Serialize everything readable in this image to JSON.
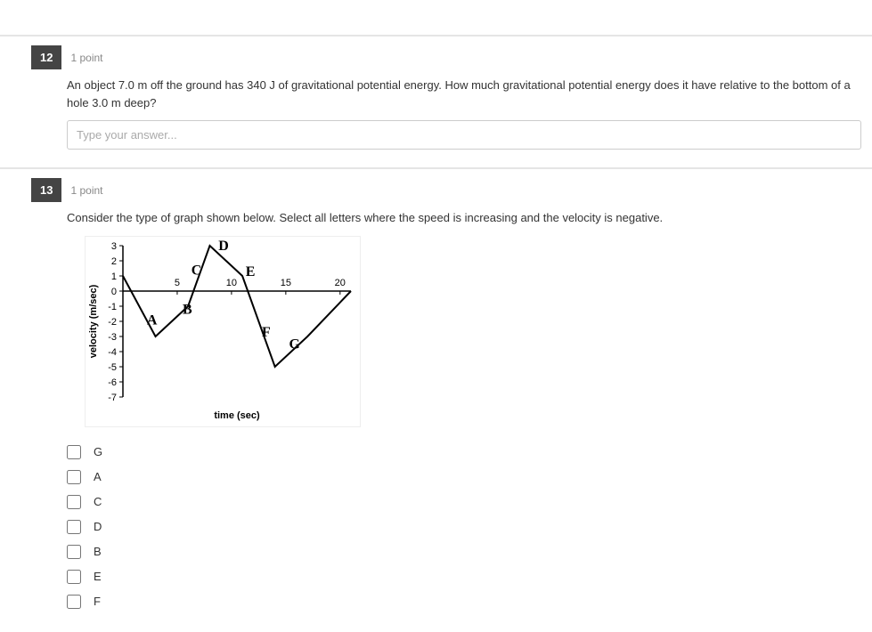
{
  "q12": {
    "number": "12",
    "points": "1 point",
    "text": "An object 7.0  m off the ground has 340  J of gravitational potential energy.  How much gravitational potential energy does it have relative to the bottom of a hole 3.0  m deep?",
    "placeholder": "Type your answer..."
  },
  "q13": {
    "number": "13",
    "points": "1 point",
    "text": "Consider the type of graph shown below. Select all letters where the speed is increasing and the velocity is negative.",
    "options": [
      "G",
      "A",
      "C",
      "D",
      "B",
      "E",
      "F"
    ]
  },
  "chart_data": {
    "type": "line",
    "title": "",
    "xlabel": "time (sec)",
    "ylabel": "velocity (m/sec)",
    "xlim": [
      0,
      21
    ],
    "ylim": [
      -7,
      3
    ],
    "yticks": [
      3,
      2,
      1,
      0,
      -1,
      -2,
      -3,
      -4,
      -5,
      -6,
      -7
    ],
    "xticks": [
      5,
      10,
      15,
      20
    ],
    "points": [
      {
        "x": 0,
        "y": 1
      },
      {
        "x": 3,
        "y": -3
      },
      {
        "x": 6,
        "y": -1
      },
      {
        "x": 8,
        "y": 3
      },
      {
        "x": 11,
        "y": 1
      },
      {
        "x": 14,
        "y": -5
      },
      {
        "x": 17,
        "y": -3
      },
      {
        "x": 21,
        "y": 0
      }
    ],
    "segment_labels": [
      {
        "name": "A",
        "x": 2.2,
        "y": -2.2
      },
      {
        "name": "B",
        "x": 5.5,
        "y": -1.5
      },
      {
        "name": "C",
        "x": 6.3,
        "y": 1.1
      },
      {
        "name": "D",
        "x": 8.8,
        "y": 2.7
      },
      {
        "name": "E",
        "x": 11.3,
        "y": 1.0
      },
      {
        "name": "F",
        "x": 12.8,
        "y": -3.0
      },
      {
        "name": "G",
        "x": 15.3,
        "y": -3.8
      }
    ]
  }
}
